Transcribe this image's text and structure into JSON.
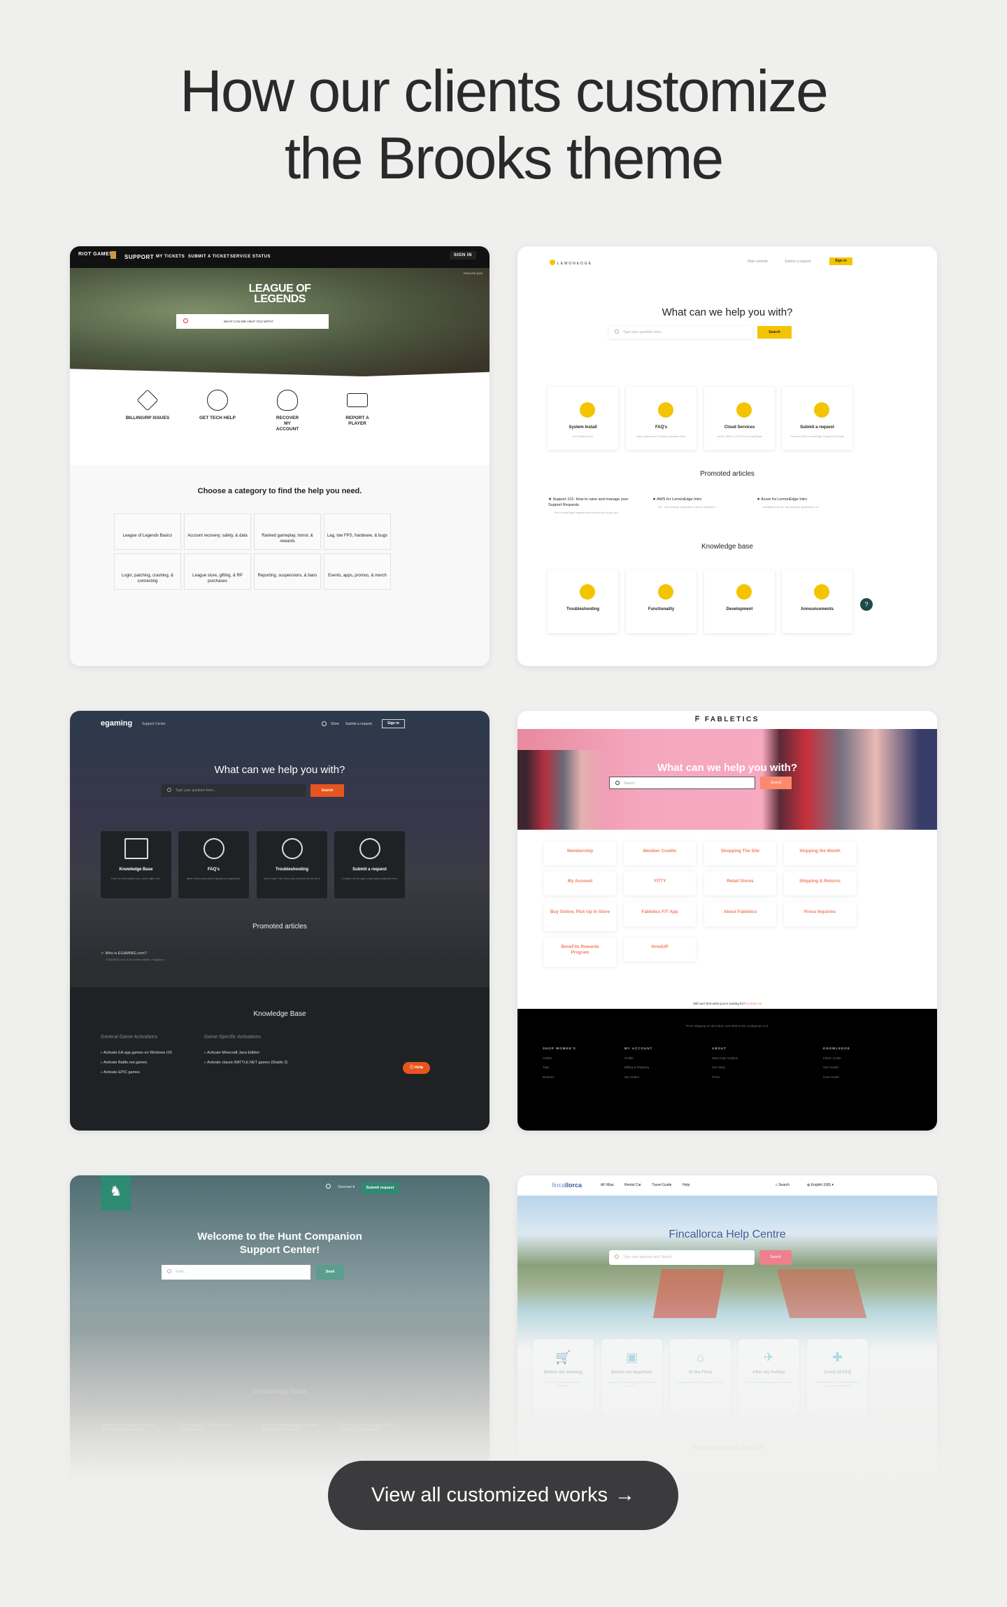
{
  "page": {
    "title_line1": "How our clients customize",
    "title_line2": "the Brooks theme",
    "cta_label": "View all customized works",
    "cta_icon": "arrow-right-icon"
  },
  "colors": {
    "background": "#efefed",
    "cta": "#3b3b3d",
    "lemon_yellow": "#f5c400",
    "egaming_orange": "#e8541e",
    "fabletics_pink": "#f3a0b8",
    "fabletics_coral": "#f47c5d",
    "hunt_green": "#2e8a73",
    "fincallorca_blue": "#3e5e99",
    "fincallorca_pink": "#ee7f8c"
  },
  "lol": {
    "nav": {
      "brand": "RIOT GAMES",
      "support": "SUPPORT",
      "links": [
        "MY TICKETS",
        "SUBMIT A TICKET",
        "SERVICE STATUS"
      ],
      "sign_in": "SIGN IN",
      "language": "ENGLISH (US)"
    },
    "logo": "LEAGUE OF LEGENDS",
    "search_placeholder": "WHAT CAN WE HELP YOU WITH?",
    "quick": [
      "BILLING/RP ISSUES",
      "GET TECH HELP",
      "RECOVER MY ACCOUNT",
      "REPORT A PLAYER"
    ],
    "heading": "Choose a category to find the help you need.",
    "categories": [
      "League of Legends Basics",
      "Account recovery, safety, & data",
      "Ranked gameplay, honor, & rewards",
      "Lag, low FPS, hardware, & bugs",
      "Login, patching, crashing, & connecting",
      "League store, gifting, & RP purchases",
      "Reporting, suspensions, & bans",
      "Events, apps, promos, & merch"
    ]
  },
  "lemon": {
    "logo": "LEMONEDGE",
    "nav": {
      "main": "Main website",
      "submit": "Submit a request",
      "sign_in": "Sign in"
    },
    "heading": "What can we help you with?",
    "search_placeholder": "Type your question here...",
    "search_button": "Search",
    "cards": [
      {
        "title": "System Install",
        "desc": "Get Started Here"
      },
      {
        "title": "FAQ's",
        "desc": "Have questions? Find the answers here"
      },
      {
        "title": "Cloud Services",
        "desc": "Azure, AWS, & GCP for LemonEdge"
      },
      {
        "title": "Submit a request",
        "desc": "Connect with LemonEdge Support Services"
      }
    ],
    "promoted_heading": "Promoted articles",
    "articles": [
      {
        "title": "Support 101: How to raise and manage your Support Requests",
        "desc": "The LemonEdge support team should be to your go..."
      },
      {
        "title": "AWS for LemonEdge Intro",
        "desc": "Our .Net desktop application can be installed i..."
      },
      {
        "title": "Azure for LemonEdge Intro",
        "desc": "Installation of our .Net desktop application on..."
      }
    ],
    "kb_heading": "Knowledge base",
    "kb": [
      "Troubleshooting",
      "Functionality",
      "Development",
      "Announcements"
    ]
  },
  "egaming": {
    "logo": "egaming",
    "subtitle": "Support Center",
    "nav": {
      "store": "Store",
      "submit": "Submit a request",
      "sign_in": "Sign in"
    },
    "heading": "What can we help you with?",
    "search_placeholder": "Type your question here...",
    "search_button": "Search",
    "cards": [
      {
        "title": "Knowledge Base",
        "desc": "Find the information you need right here."
      },
      {
        "title": "FAQ's",
        "desc": "Most commonly asked questions explained."
      },
      {
        "title": "Troubleshooting",
        "desc": "Need help? We have you covered all the time"
      },
      {
        "title": "Submit a request",
        "desc": "Contact us through a specially prepared form"
      }
    ],
    "promoted_heading": "Promoted articles",
    "article": {
      "title": "Who is EGAMING.com?",
      "desc": "EGAMING.com is an online retailer of digital pr..."
    },
    "kb_heading": "Knowledge Base",
    "columns": [
      {
        "title": "General Game Activations",
        "items": [
          "Activate EA app games on Windows OS",
          "Activate Battle.net games",
          "Activate EPIC games"
        ]
      },
      {
        "title": "Game Specific Activations",
        "items": [
          "Activate Minecraft Java Edition",
          "Activate classic BATTLE.NET games (Diablo 2)"
        ]
      }
    ],
    "help": "Help"
  },
  "fab": {
    "logo": "FABLETICS",
    "heading": "What can we help you with?",
    "search_placeholder": "Search",
    "search_button": "Search",
    "tiles": [
      "Membership",
      "Member Credits",
      "Shopping The Site",
      "Skipping the Month",
      "My Account",
      "YITTY",
      "Retail Stores",
      "Shipping & Returns",
      "Buy Online, Pick Up In Store",
      "Fabletics FIT App",
      "About Fabletics",
      "Press Inquiries",
      "BeneFits Rewards Program",
      "thredUP"
    ],
    "still": "Still can't find what you're looking for?",
    "contact": "Contact Us",
    "shipping": "*Free shipping on all orders over $49 in the contiguous U.S.",
    "footer": [
      {
        "title": "SHOP WOMEN'S",
        "items": [
          "Outfits",
          "Tops",
          "Bottoms"
        ]
      },
      {
        "title": "MY ACCOUNT",
        "items": [
          "Profile",
          "Billing & Shipping",
          "My Orders"
        ]
      },
      {
        "title": "ABOUT",
        "items": [
          "Meet Kate Hudson",
          "Our Story",
          "Press"
        ]
      },
      {
        "title": "KNOWLEDGE",
        "items": [
          "Fabric Guide",
          "Size Guide",
          "Care Guide"
        ]
      }
    ]
  },
  "hunt": {
    "nav": {
      "language": "German",
      "submit": "Submit request"
    },
    "heading_line1": "Welcome to the Hunt Companion",
    "heading_line2": "Support Center!",
    "search_placeholder": "Seek...",
    "search_button": "Seek",
    "kb_heading": "knowledge base",
    "cards": [
      "General information about hunting companions",
      "Functions of the hunting companion",
      "Account management in the hunting companion",
      "Free vs. Pro version of the hunting companion"
    ]
  },
  "finca": {
    "logo_a": "finca",
    "logo_b": "llorca",
    "nav": [
      "All Villas",
      "Rental Car",
      "Travel Guide",
      "Help"
    ],
    "search": "Search",
    "language": "English (GB)",
    "heading": "Fincallorca Help Centre",
    "search_placeholder": "Type your question and 'Search'",
    "search_button": "Search",
    "cards": [
      {
        "title": "Before the booking",
        "desc": "Book your Finca holiday with confidence",
        "icon": "cart-icon"
      },
      {
        "title": "Before my departure",
        "desc": "Manage your booking, and get ready for your trip",
        "icon": "luggage-icon"
      },
      {
        "title": "At the Finca",
        "desc": "In case you need help during your stay",
        "icon": "home-icon"
      },
      {
        "title": "After my holiday",
        "desc": "Request a refund or give us feedback",
        "icon": "plane-landing-icon"
      },
      {
        "title": "Covid-19 FAQ",
        "desc": "All info related to travel restrictions, documents and testing",
        "icon": "health-hand-icon"
      }
    ],
    "recommended": "Recommended articles"
  }
}
